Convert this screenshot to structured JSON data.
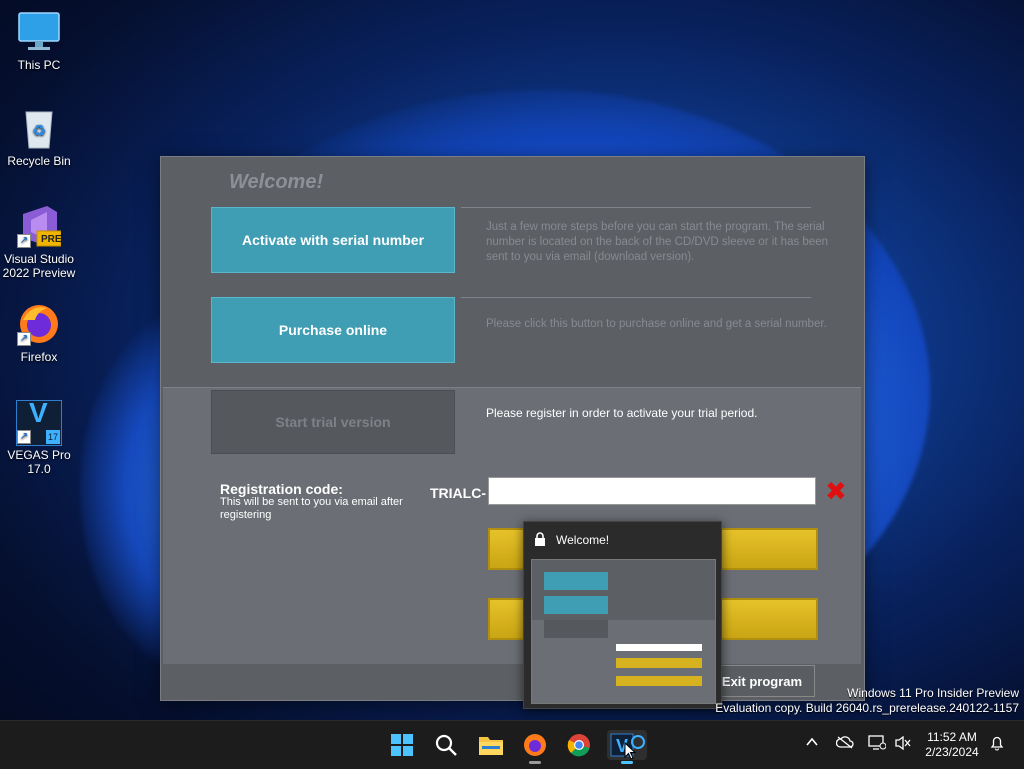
{
  "desktop": {
    "icons": [
      {
        "label": "This PC"
      },
      {
        "label": "Recycle Bin"
      },
      {
        "label": "Visual Studio 2022 Preview",
        "badge": "PRE"
      },
      {
        "label": "Firefox"
      },
      {
        "label": "VEGAS Pro 17.0",
        "glyph": "V",
        "badge": "17"
      }
    ]
  },
  "dialog": {
    "title": "Welcome!",
    "activate_button": "Activate with serial number",
    "activate_desc": "Just a few more steps before you can start the program. The serial number is located on the back of the CD/DVD sleeve or it has been sent to you via email (download version).",
    "purchase_button": "Purchase online",
    "purchase_desc": "Please click this button to purchase online and get a serial number.",
    "trial_button": "Start trial version",
    "trial_desc": "Please register in order to activate your trial period.",
    "reg_label": "Registration code:",
    "reg_sub": "This will be sent to you via email after registering",
    "reg_prefix": "TRIALC-",
    "reg_value": "",
    "exit_button": "Exit program"
  },
  "preview": {
    "title": "Welcome!"
  },
  "watermark": {
    "line1": "Windows 11 Pro Insider Preview",
    "line2": "Evaluation copy. Build 26040.rs_prerelease.240122-1157"
  },
  "clock": {
    "time": "11:52 AM",
    "date": "2/23/2024"
  },
  "colors": {
    "teal": "#3f9db4",
    "yellow": "#d6b21e",
    "dialog_bg": "#5c5f63",
    "taskbar": "#1c1c1c"
  }
}
